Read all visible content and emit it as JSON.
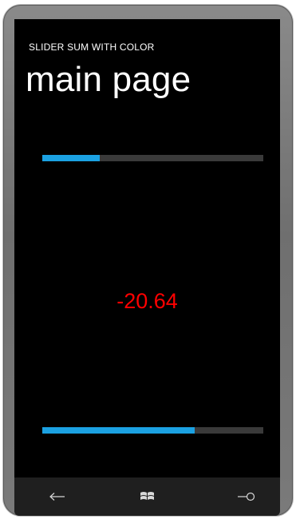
{
  "app": {
    "title": "SLIDER SUM WITH COLOR",
    "page_title": "main page"
  },
  "sliders": {
    "top": {
      "value_fraction": 0.26
    },
    "bottom": {
      "value_fraction": 0.69
    }
  },
  "result": {
    "sum_text": "-20.64",
    "color": "#ff0000"
  },
  "accent_color": "#1ba1e2",
  "app_bar": {
    "back_icon": "back-arrow-icon",
    "start_icon": "windows-start-icon",
    "search_icon": "search-icon"
  }
}
